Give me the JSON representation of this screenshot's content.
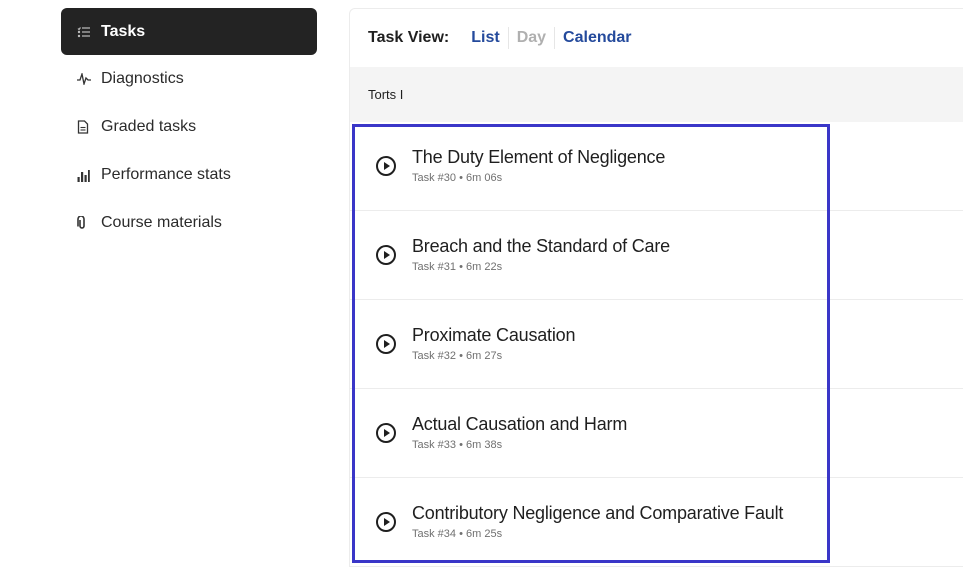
{
  "sidebar": {
    "items": [
      {
        "label": "Tasks",
        "icon": "list-icon",
        "active": true
      },
      {
        "label": "Diagnostics",
        "icon": "pulse-icon",
        "active": false
      },
      {
        "label": "Graded tasks",
        "icon": "document-icon",
        "active": false
      },
      {
        "label": "Performance stats",
        "icon": "bar-chart-icon",
        "active": false
      },
      {
        "label": "Course materials",
        "icon": "paperclip-icon",
        "active": false
      }
    ]
  },
  "main": {
    "view_label": "Task View:",
    "view_options": [
      {
        "label": "List",
        "state": "selected"
      },
      {
        "label": "Day",
        "state": "disabled"
      },
      {
        "label": "Calendar",
        "state": "selected"
      }
    ],
    "section_title": "Torts I",
    "tasks": [
      {
        "title": "The Duty Element of Negligence",
        "meta": "Task #30 • 6m 06s"
      },
      {
        "title": "Breach and the Standard of Care",
        "meta": "Task #31 • 6m 22s"
      },
      {
        "title": "Proximate Causation",
        "meta": "Task #32 • 6m 27s"
      },
      {
        "title": "Actual Causation and Harm",
        "meta": "Task #33 • 6m 38s"
      },
      {
        "title": "Contributory Negligence and Comparative Fault",
        "meta": "Task #34 • 6m 25s"
      }
    ]
  },
  "colors": {
    "accent": "#244a9c",
    "highlight": "#3a36c8",
    "active_nav_bg": "#232323"
  }
}
